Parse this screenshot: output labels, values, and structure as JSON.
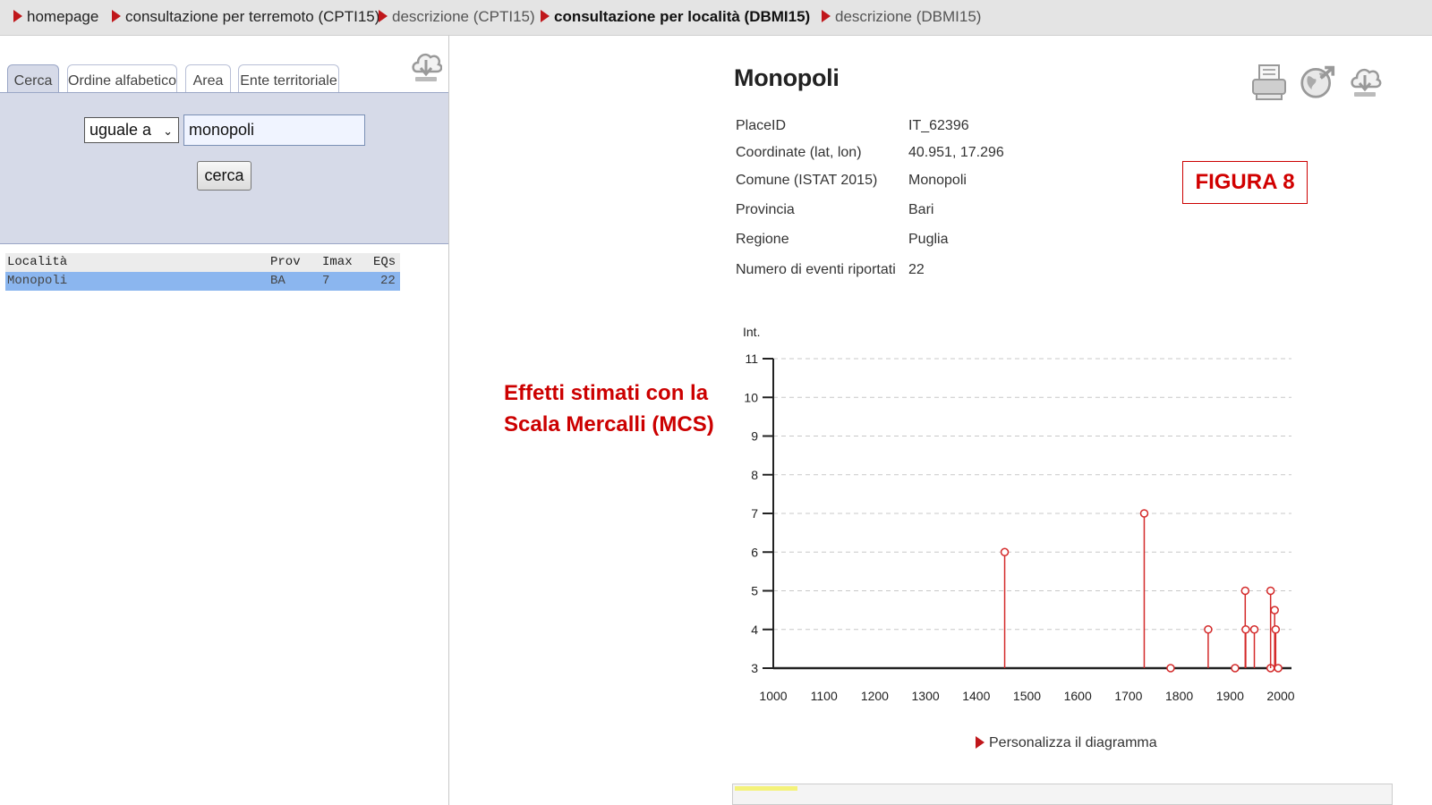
{
  "breadcrumbs": [
    {
      "label": "homepage"
    },
    {
      "label": "consultazione per terremoto (CPTI15)"
    },
    {
      "label": "descrizione (CPTI15)"
    },
    {
      "label": "consultazione per località (DBMI15)"
    },
    {
      "label": "descrizione (DBMI15)"
    }
  ],
  "search": {
    "tabs": [
      "Cerca",
      "Ordine alfabetico",
      "Area",
      "Ente territoriale"
    ],
    "operator_selected": "uguale a",
    "term_value": "monopoli",
    "button_label": "cerca"
  },
  "results": {
    "columns": [
      "Località",
      "Prov",
      "Imax",
      "EQs"
    ],
    "rows": [
      {
        "localita": "Monopoli",
        "prov": "BA",
        "imax": "7",
        "eqs": "22"
      }
    ]
  },
  "place": {
    "title": "Monopoli",
    "fields": [
      {
        "label": "PlaceID",
        "value": "IT_62396"
      },
      {
        "label": "Coordinate (lat, lon)",
        "value": "40.951, 17.296"
      },
      {
        "label": "Comune (ISTAT 2015)",
        "value": "Monopoli"
      },
      {
        "label": "Provincia",
        "value": "Bari"
      },
      {
        "label": "Regione",
        "value": "Puglia"
      },
      {
        "label": "Numero di eventi riportati",
        "value": "22"
      }
    ]
  },
  "annotations": {
    "figura_label": "FIGURA 8",
    "note_line1": "Effetti stimati con la",
    "note_line2": "Scala Mercalli (MCS)"
  },
  "icons": {
    "left_download": "cloud-download-icon",
    "print": "printer-icon",
    "map_export": "globe-export-icon",
    "download": "cloud-download-icon"
  },
  "colors": {
    "accent_red": "#c0171b",
    "stem_red": "#d42a2a",
    "selection_blue": "#8bb6ef",
    "search_panel": "#d6dae8"
  },
  "chart_data": {
    "type": "scatter",
    "style": "stem",
    "ylabel": "Int.",
    "xlim": [
      1000,
      2000
    ],
    "ylim": [
      3,
      11
    ],
    "x_ticks": [
      1000,
      1100,
      1200,
      1300,
      1400,
      1500,
      1600,
      1700,
      1800,
      1900,
      2000
    ],
    "y_ticks": [
      3,
      4,
      5,
      6,
      7,
      8,
      9,
      10,
      11
    ],
    "grid": "horizontal dashed",
    "points": [
      {
        "x": 1456,
        "y": 6
      },
      {
        "x": 1731,
        "y": 7
      },
      {
        "x": 1783,
        "y": 3
      },
      {
        "x": 1857,
        "y": 4
      },
      {
        "x": 1910,
        "y": 3
      },
      {
        "x": 1930,
        "y": 5
      },
      {
        "x": 1931,
        "y": 4
      },
      {
        "x": 1948,
        "y": 4
      },
      {
        "x": 1980,
        "y": 3
      },
      {
        "x": 1980,
        "y": 5
      },
      {
        "x": 1988,
        "y": 4.5
      },
      {
        "x": 1990,
        "y": 4
      },
      {
        "x": 1995,
        "y": 3
      }
    ],
    "customize_label": "Personalizza il diagramma"
  }
}
